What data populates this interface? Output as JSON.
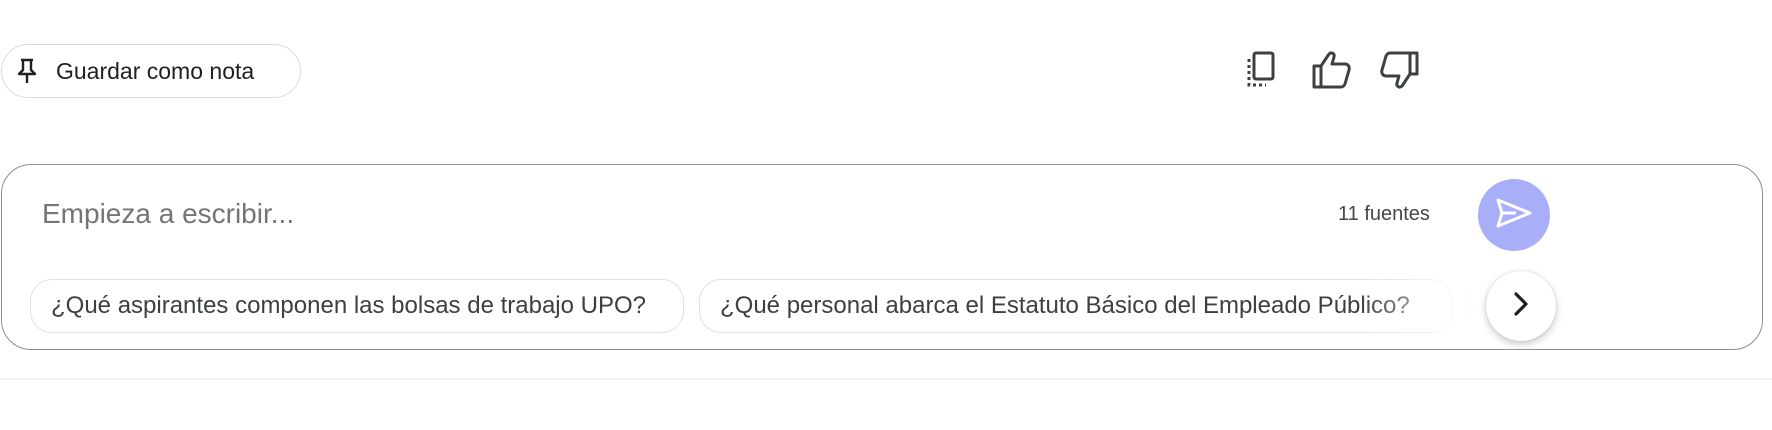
{
  "note_button": {
    "label": "Guardar como nota",
    "icon": "pin-icon"
  },
  "response_actions": [
    {
      "name": "copy",
      "icon": "copy-icon"
    },
    {
      "name": "good-response",
      "icon": "thumbs-up-icon"
    },
    {
      "name": "bad-response",
      "icon": "thumbs-down-icon"
    }
  ],
  "composer": {
    "input_placeholder": "Empieza a escribir...",
    "input_value": "",
    "sources_count_label": "11 fuentes",
    "send_icon": "send-icon",
    "send_color": "#a8aef8",
    "suggestions": [
      "¿Qué aspirantes componen las bolsas de trabajo UPO?",
      "¿Qué personal abarca el Estatuto Básico del Empleado Público?"
    ],
    "next_icon": "chevron-right-icon"
  }
}
